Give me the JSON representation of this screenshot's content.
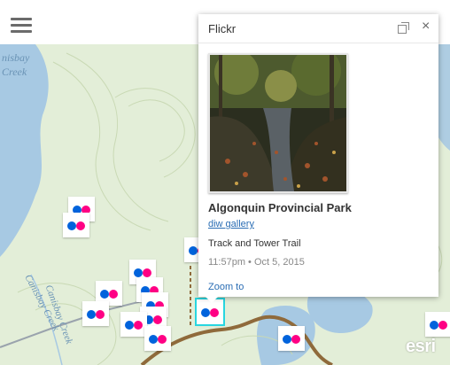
{
  "map": {
    "lake_label_1": "nisbay",
    "lake_label_2": "Creek",
    "creek_label_1": "Canisbay Creek",
    "creek_label_2": "Canisbay Creek",
    "attribution_logo": "esri",
    "colors": {
      "land": "#e3eed8",
      "water": "#a7c9e3",
      "contour": "#c9d9b4",
      "trail": "#8f6a3b",
      "road": "#9aa3ad",
      "marker_blue": "#0063dc",
      "marker_pink": "#ff0084",
      "selected_outline": "#28d6e0"
    }
  },
  "topbar": {
    "menu_icon": "hamburger-menu-icon"
  },
  "popup": {
    "title": "Flickr",
    "dock_icon": "dock-icon",
    "close_label": "×",
    "heading": "Algonquin Provincial Park",
    "link_text": "diw gallery",
    "description": "Track and Tower Trail",
    "date": "11:57pm • Oct 5, 2015",
    "zoom_label": "Zoom to"
  },
  "markers": {
    "count_visible": 15
  }
}
